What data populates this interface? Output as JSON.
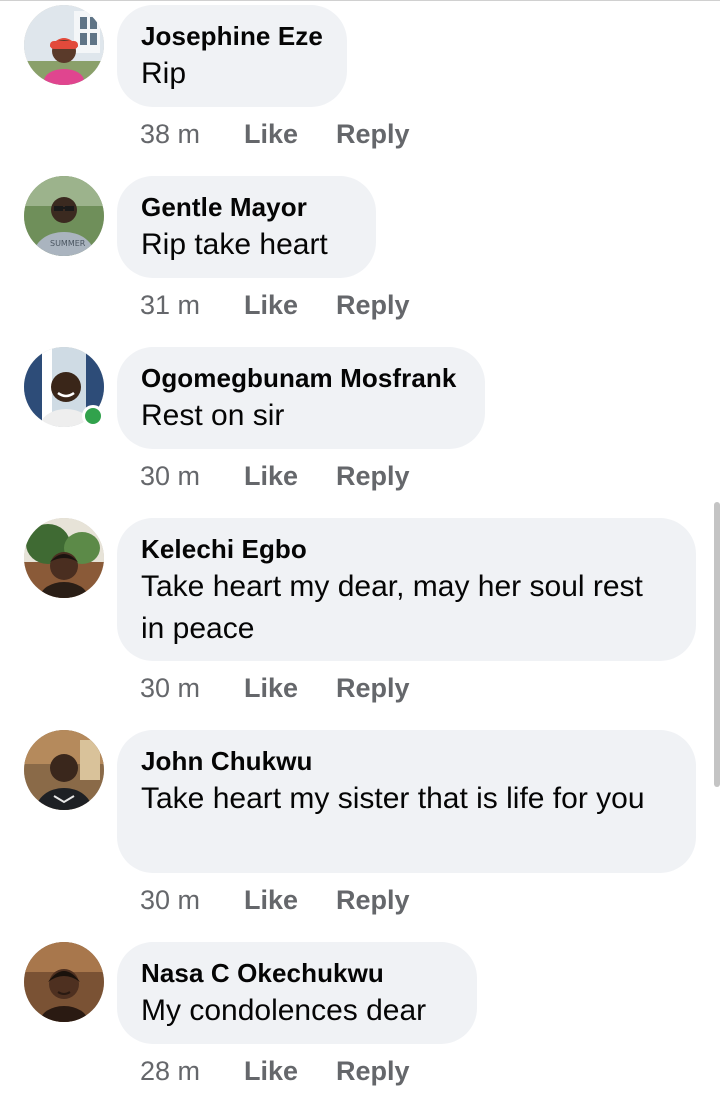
{
  "comments": [
    {
      "author": "Josephine Eze",
      "text": "Rip",
      "time": "38 m",
      "like": "Like",
      "reply": "Reply",
      "avatar": "avatar-photo-woman-red-cap"
    },
    {
      "author": "Gentle Mayor",
      "text": "Rip take heart",
      "time": "31 m",
      "like": "Like",
      "reply": "Reply",
      "avatar": "avatar-photo-man-glasses"
    },
    {
      "author": "Ogomegbunam Mosfrank",
      "text": "Rest on sir",
      "time": "30 m",
      "like": "Like",
      "reply": "Reply",
      "avatar": "avatar-photo-man-smiling",
      "online": true
    },
    {
      "author": "Kelechi Egbo",
      "text": "Take heart my dear, may her soul rest in peace",
      "time": "30 m",
      "like": "Like",
      "reply": "Reply",
      "avatar": "avatar-photo-woman-outdoors"
    },
    {
      "author": "John Chukwu",
      "text": "Take heart my sister that is life for you",
      "time": "30 m",
      "like": "Like",
      "reply": "Reply",
      "avatar": "avatar-photo-man-indoors"
    },
    {
      "author": "Nasa C Okechukwu",
      "text": "My condolences dear",
      "time": "28 m",
      "like": "Like",
      "reply": "Reply",
      "avatar": "avatar-photo-woman-selfie"
    }
  ],
  "colors": {
    "bubble": "#f0f2f5",
    "meta": "#65676b",
    "online": "#31a24c"
  }
}
